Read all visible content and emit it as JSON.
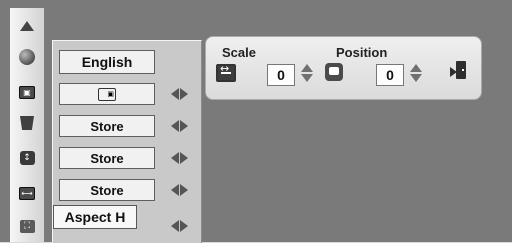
{
  "menu": {
    "language": "English",
    "items": [
      {
        "label": "",
        "icon": "picture-in-picture-icon"
      },
      {
        "label": "Store"
      },
      {
        "label": "Store"
      },
      {
        "label": "Store"
      }
    ],
    "tooltip": "Aspect H"
  },
  "scale_panel": {
    "scale_label": "Scale",
    "position_label": "Position",
    "scale_value": "0",
    "position_value": "0"
  }
}
